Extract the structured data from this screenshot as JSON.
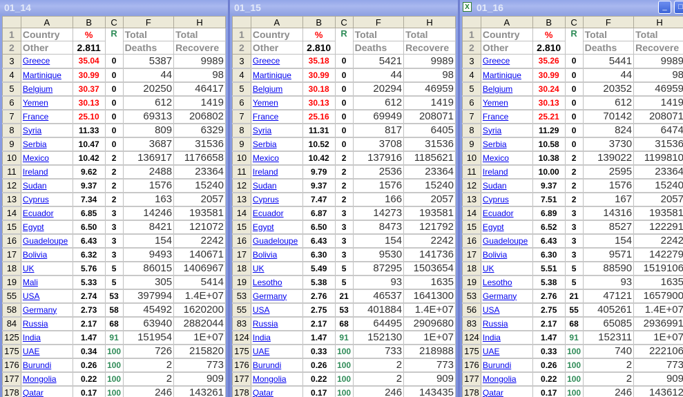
{
  "colors": {
    "high_percent": "#ff0000",
    "high_rank": "#2e8b57",
    "link": "#0000ee"
  },
  "headers": {
    "col_letters": [
      "A",
      "B",
      "C",
      "F",
      "H"
    ],
    "row1": {
      "a": "Country",
      "b": "%",
      "c": "R",
      "f": "Total",
      "h": "Total"
    },
    "row2": {
      "a": "Other",
      "f": "Deaths",
      "h": "Recovere"
    }
  },
  "windows": [
    {
      "title": "01_14",
      "average": "2.811",
      "rows": [
        [
          "3",
          "Greece",
          "35.04",
          "0",
          "5387",
          "9989"
        ],
        [
          "4",
          "Martinique",
          "30.99",
          "0",
          "44",
          "98"
        ],
        [
          "5",
          "Belgium",
          "30.37",
          "0",
          "20250",
          "46417"
        ],
        [
          "6",
          "Yemen",
          "30.13",
          "0",
          "612",
          "1419"
        ],
        [
          "7",
          "France",
          "25.10",
          "0",
          "69313",
          "206802"
        ],
        [
          "8",
          "Syria",
          "11.33",
          "0",
          "809",
          "6329"
        ],
        [
          "9",
          "Serbia",
          "10.47",
          "0",
          "3687",
          "31536"
        ],
        [
          "10",
          "Mexico",
          "10.42",
          "2",
          "136917",
          "1176658"
        ],
        [
          "11",
          "Ireland",
          "9.62",
          "2",
          "2488",
          "23364"
        ],
        [
          "12",
          "Sudan",
          "9.37",
          "2",
          "1576",
          "15240"
        ],
        [
          "13",
          "Cyprus",
          "7.34",
          "2",
          "163",
          "2057"
        ],
        [
          "14",
          "Ecuador",
          "6.85",
          "3",
          "14246",
          "193581"
        ],
        [
          "15",
          "Egypt",
          "6.50",
          "3",
          "8421",
          "121072"
        ],
        [
          "16",
          "Guadeloupe",
          "6.43",
          "3",
          "154",
          "2242"
        ],
        [
          "17",
          "Bolivia",
          "6.32",
          "3",
          "9493",
          "140671"
        ],
        [
          "18",
          "UK",
          "5.76",
          "5",
          "86015",
          "1406967"
        ],
        [
          "19",
          "Mali",
          "5.33",
          "5",
          "305",
          "5414"
        ],
        [
          "55",
          "USA",
          "2.74",
          "53",
          "397994",
          "1.4E+07"
        ],
        [
          "58",
          "Germany",
          "2.73",
          "58",
          "45492",
          "1620200"
        ],
        [
          "84",
          "Russia",
          "2.17",
          "68",
          "63940",
          "2882044"
        ],
        [
          "125",
          "India",
          "1.47",
          "91",
          "151954",
          "1E+07"
        ],
        [
          "175",
          "UAE",
          "0.34",
          "100",
          "726",
          "215820"
        ],
        [
          "176",
          "Burundi",
          "0.26",
          "100",
          "2",
          "773"
        ],
        [
          "177",
          "Mongolia",
          "0.22",
          "100",
          "2",
          "909"
        ],
        [
          "178",
          "Qatar",
          "0.17",
          "100",
          "246",
          "143261"
        ]
      ]
    },
    {
      "title": "01_15",
      "average": "2.810",
      "rows": [
        [
          "3",
          "Greece",
          "35.18",
          "0",
          "5421",
          "9989"
        ],
        [
          "4",
          "Martinique",
          "30.99",
          "0",
          "44",
          "98"
        ],
        [
          "5",
          "Belgium",
          "30.18",
          "0",
          "20294",
          "46959"
        ],
        [
          "6",
          "Yemen",
          "30.13",
          "0",
          "612",
          "1419"
        ],
        [
          "7",
          "France",
          "25.16",
          "0",
          "69949",
          "208071"
        ],
        [
          "8",
          "Syria",
          "11.31",
          "0",
          "817",
          "6405"
        ],
        [
          "9",
          "Serbia",
          "10.52",
          "0",
          "3708",
          "31536"
        ],
        [
          "10",
          "Mexico",
          "10.42",
          "2",
          "137916",
          "1185621"
        ],
        [
          "11",
          "Ireland",
          "9.79",
          "2",
          "2536",
          "23364"
        ],
        [
          "12",
          "Sudan",
          "9.37",
          "2",
          "1576",
          "15240"
        ],
        [
          "13",
          "Cyprus",
          "7.47",
          "2",
          "166",
          "2057"
        ],
        [
          "14",
          "Ecuador",
          "6.87",
          "3",
          "14273",
          "193581"
        ],
        [
          "15",
          "Egypt",
          "6.50",
          "3",
          "8473",
          "121792"
        ],
        [
          "16",
          "Guadeloupe",
          "6.43",
          "3",
          "154",
          "2242"
        ],
        [
          "17",
          "Bolivia",
          "6.30",
          "3",
          "9530",
          "141736"
        ],
        [
          "18",
          "UK",
          "5.49",
          "5",
          "87295",
          "1503654"
        ],
        [
          "19",
          "Lesotho",
          "5.38",
          "5",
          "93",
          "1635"
        ],
        [
          "53",
          "Germany",
          "2.76",
          "21",
          "46537",
          "1641300"
        ],
        [
          "55",
          "USA",
          "2.75",
          "53",
          "401884",
          "1.4E+07"
        ],
        [
          "83",
          "Russia",
          "2.17",
          "68",
          "64495",
          "2909680"
        ],
        [
          "124",
          "India",
          "1.47",
          "91",
          "152130",
          "1E+07"
        ],
        [
          "175",
          "UAE",
          "0.33",
          "100",
          "733",
          "218988"
        ],
        [
          "176",
          "Burundi",
          "0.26",
          "100",
          "2",
          "773"
        ],
        [
          "177",
          "Mongolia",
          "0.22",
          "100",
          "2",
          "909"
        ],
        [
          "178",
          "Qatar",
          "0.17",
          "100",
          "246",
          "143435"
        ]
      ]
    },
    {
      "title": "01_16",
      "average": "2.810",
      "rows": [
        [
          "3",
          "Greece",
          "35.26",
          "0",
          "5441",
          "9989"
        ],
        [
          "4",
          "Martinique",
          "30.99",
          "0",
          "44",
          "98"
        ],
        [
          "5",
          "Belgium",
          "30.24",
          "0",
          "20352",
          "46959"
        ],
        [
          "6",
          "Yemen",
          "30.13",
          "0",
          "612",
          "1419"
        ],
        [
          "7",
          "France",
          "25.21",
          "0",
          "70142",
          "208071"
        ],
        [
          "8",
          "Syria",
          "11.29",
          "0",
          "824",
          "6474"
        ],
        [
          "9",
          "Serbia",
          "10.58",
          "0",
          "3730",
          "31536"
        ],
        [
          "10",
          "Mexico",
          "10.38",
          "2",
          "139022",
          "1199810"
        ],
        [
          "11",
          "Ireland",
          "10.00",
          "2",
          "2595",
          "23364"
        ],
        [
          "12",
          "Sudan",
          "9.37",
          "2",
          "1576",
          "15240"
        ],
        [
          "13",
          "Cyprus",
          "7.51",
          "2",
          "167",
          "2057"
        ],
        [
          "14",
          "Ecuador",
          "6.89",
          "3",
          "14316",
          "193581"
        ],
        [
          "15",
          "Egypt",
          "6.52",
          "3",
          "8527",
          "122291"
        ],
        [
          "16",
          "Guadeloupe",
          "6.43",
          "3",
          "154",
          "2242"
        ],
        [
          "17",
          "Bolivia",
          "6.30",
          "3",
          "9571",
          "142279"
        ],
        [
          "18",
          "UK",
          "5.51",
          "5",
          "88590",
          "1519106"
        ],
        [
          "19",
          "Lesotho",
          "5.38",
          "5",
          "93",
          "1635"
        ],
        [
          "53",
          "Germany",
          "2.76",
          "21",
          "47121",
          "1657900"
        ],
        [
          "56",
          "USA",
          "2.75",
          "55",
          "405261",
          "1.4E+07"
        ],
        [
          "83",
          "Russia",
          "2.17",
          "68",
          "65085",
          "2936991"
        ],
        [
          "124",
          "India",
          "1.47",
          "91",
          "152311",
          "1E+07"
        ],
        [
          "175",
          "UAE",
          "0.33",
          "100",
          "740",
          "222106"
        ],
        [
          "176",
          "Burundi",
          "0.26",
          "100",
          "2",
          "773"
        ],
        [
          "177",
          "Mongolia",
          "0.22",
          "100",
          "2",
          "909"
        ],
        [
          "178",
          "Qatar",
          "0.17",
          "100",
          "246",
          "143612"
        ]
      ]
    }
  ]
}
